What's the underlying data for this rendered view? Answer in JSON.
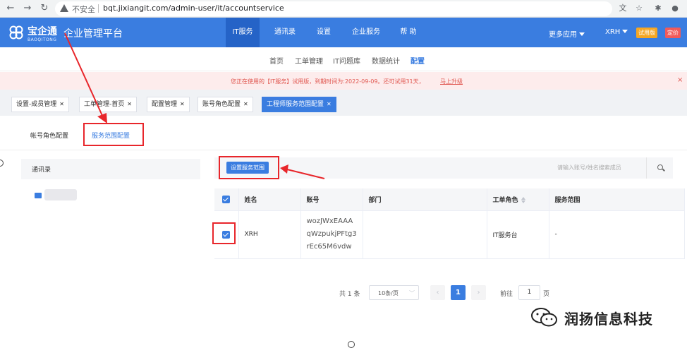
{
  "browser": {
    "security_label": "不安全",
    "url": "bqt.jixiangit.com/admin-user/it/accountservice"
  },
  "header": {
    "logo_name": "宝企通",
    "logo_sub": "BAOQITONG",
    "platform_title": "企业管理平台",
    "nav": [
      "IT服务",
      "通讯录",
      "设置",
      "企业服务",
      "帮 助"
    ],
    "more_apps": "更多应用",
    "user": "XRH",
    "trial_badge": "试用版",
    "price_badge": "定价",
    "colors": {
      "primary": "#3a7de0",
      "trial": "#f5a623",
      "price": "#f05a5a",
      "annotation": "#e8262b"
    }
  },
  "subnav": [
    "首页",
    "工单管理",
    "IT问题库",
    "数据统计",
    "配置"
  ],
  "notice": {
    "text": "您正在使用的【IT服务】试用版，到期时间为:2022-09-09。还可试用31天，",
    "link": "马上升级",
    "close": "×"
  },
  "page_tabs": [
    "设置-成员管理",
    "工单管理-首页",
    "配置管理",
    "账号角色配置",
    "工程师服务范围配置"
  ],
  "sub_tabs": [
    "帐号角色配置",
    "服务范围配置"
  ],
  "left_panel": {
    "title": "通讯录"
  },
  "toolbar": {
    "set_button": "设置服务范围",
    "search_placeholder": "请输入账号/姓名搜索成员"
  },
  "table": {
    "headers": [
      "姓名",
      "账号",
      "部门",
      "工单角色",
      "服务范围"
    ],
    "rows": [
      {
        "name": "XRH",
        "account": [
          "wozJWxEAAA",
          "qWzpukjPFtg3",
          "rEc65M6vdw"
        ],
        "dept": "",
        "role": "IT服务台",
        "scope": "-"
      }
    ]
  },
  "pagination": {
    "total": "共 1 条",
    "page_size": "10条/页",
    "current": "1",
    "goto_label": "前往",
    "goto_value": "1",
    "unit": "页"
  },
  "watermark": "润扬信息科技"
}
